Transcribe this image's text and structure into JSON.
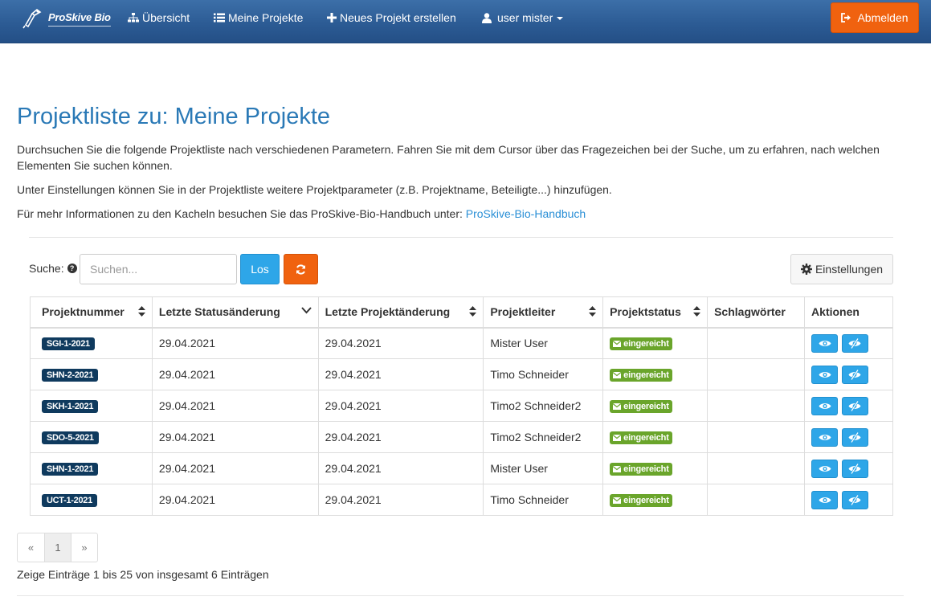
{
  "navbar": {
    "brand": "ProSkive Bio",
    "items": [
      {
        "label": "Übersicht",
        "icon": "sitemap-icon"
      },
      {
        "label": "Meine Projekte",
        "icon": "list-icon"
      },
      {
        "label": "Neues Projekt erstellen",
        "icon": "plus-icon"
      },
      {
        "label": "user mister",
        "icon": "user-icon"
      }
    ],
    "logout": "Abmelden"
  },
  "page": {
    "title": "Projektliste zu: Meine Projekte",
    "intro": "Durchsuchen Sie die folgende Projektliste nach verschiedenen Parametern. Fahren Sie mit dem Cursor über das Fragezeichen bei der Suche, um zu erfahren, nach welchen Elementen Sie suchen können.",
    "settings_hint": "Unter Einstellungen können Sie in der Projektliste weitere Projektparameter (z.B. Projektname, Beteiligte...) hinzufügen.",
    "handbook_text": "Für mehr Informationen zu den Kacheln besuchen Sie das ProSkive-Bio-Handbuch unter: ",
    "handbook_link": "ProSkive-Bio-Handbuch"
  },
  "search": {
    "label": "Suche:",
    "placeholder": "Suchen...",
    "go_label": "Los",
    "settings_label": "Einstellungen"
  },
  "table": {
    "headers": [
      "Projektnummer",
      "Letzte Statusänderung",
      "Letzte Projektänderung",
      "Projektleiter",
      "Projektstatus",
      "Schlagwörter",
      "Aktionen"
    ],
    "rows": [
      {
        "id": "SGI-1-2021",
        "status_change": "29.04.2021",
        "project_change": "29.04.2021",
        "leader": "Mister User",
        "status": "eingereicht",
        "tags": ""
      },
      {
        "id": "SHN-2-2021",
        "status_change": "29.04.2021",
        "project_change": "29.04.2021",
        "leader": "Timo Schneider",
        "status": "eingereicht",
        "tags": ""
      },
      {
        "id": "SKH-1-2021",
        "status_change": "29.04.2021",
        "project_change": "29.04.2021",
        "leader": "Timo2 Schneider2",
        "status": "eingereicht",
        "tags": ""
      },
      {
        "id": "SDO-5-2021",
        "status_change": "29.04.2021",
        "project_change": "29.04.2021",
        "leader": "Timo2 Schneider2",
        "status": "eingereicht",
        "tags": ""
      },
      {
        "id": "SHN-1-2021",
        "status_change": "29.04.2021",
        "project_change": "29.04.2021",
        "leader": "Mister User",
        "status": "eingereicht",
        "tags": ""
      },
      {
        "id": "UCT-1-2021",
        "status_change": "29.04.2021",
        "project_change": "29.04.2021",
        "leader": "Timo Schneider",
        "status": "eingereicht",
        "tags": ""
      }
    ]
  },
  "pagination": {
    "prev": "«",
    "current": "1",
    "next": "»"
  },
  "footer_info": "Zeige Einträge 1 bis 25 von insgesamt 6 Einträgen",
  "colors": {
    "nav": "#2b5a93",
    "accent_orange": "#f0620f",
    "accent_blue": "#2ea6e8",
    "title": "#2a79b6",
    "badge_dark": "#0f3a5e",
    "badge_green": "#6aa52b"
  }
}
